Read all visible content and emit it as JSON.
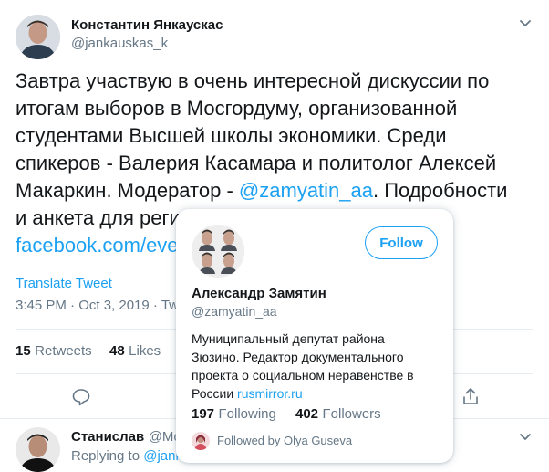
{
  "tweet": {
    "author_name": "Константин Янкаускас",
    "author_handle": "@jankauskas_k",
    "text_lines": [
      "Завтра участвую в очень интересной дискуссии по",
      "итогам выборов в Мосгордуму, организованной",
      "студентами Высшей школы экономики. Среди",
      "спикеров - Валерия Касамара и политолог Алексей"
    ],
    "line5_prefix": "Макаркин. Модератор - ",
    "mention": "@zamyatin_aa",
    "line5_suffix": ". Подробности",
    "line6_visible": "и анкета для реги",
    "link_visible": "facebook.com/eve",
    "translate_label": "Translate Tweet",
    "timestamp": "3:45 PM · Oct 3, 2019 · ",
    "source_partial": "Tw",
    "retweets_count": "15",
    "retweets_label": "Retweets",
    "likes_count": "48",
    "likes_label": "Likes"
  },
  "icons": {
    "caret": "chevron-down-icon",
    "reply": "reply-icon",
    "share": "share-icon"
  },
  "reply": {
    "author_name": "Станислав",
    "author_handle_partial": "@Mo",
    "replying_prefix": "Replying to ",
    "replying_handle_partial": "@jank"
  },
  "hover_card": {
    "name": "Александр Замятин",
    "handle": "@zamyatin_aa",
    "follow_label": "Follow",
    "bio_lines": [
      "Муниципальный депутат района",
      "Зюзино. Редактор документального",
      "проекта о социальном неравенстве в"
    ],
    "bio_last_prefix": "России ",
    "bio_link": "rusmirror.ru",
    "following_count": "197",
    "following_label": "Following",
    "followers_count": "402",
    "followers_label": "Followers",
    "followed_by": "Followed by Olya Guseva"
  },
  "colors": {
    "accent": "#1da1f2",
    "text": "#14171a",
    "muted": "#657786",
    "border": "#e6ecf0"
  }
}
